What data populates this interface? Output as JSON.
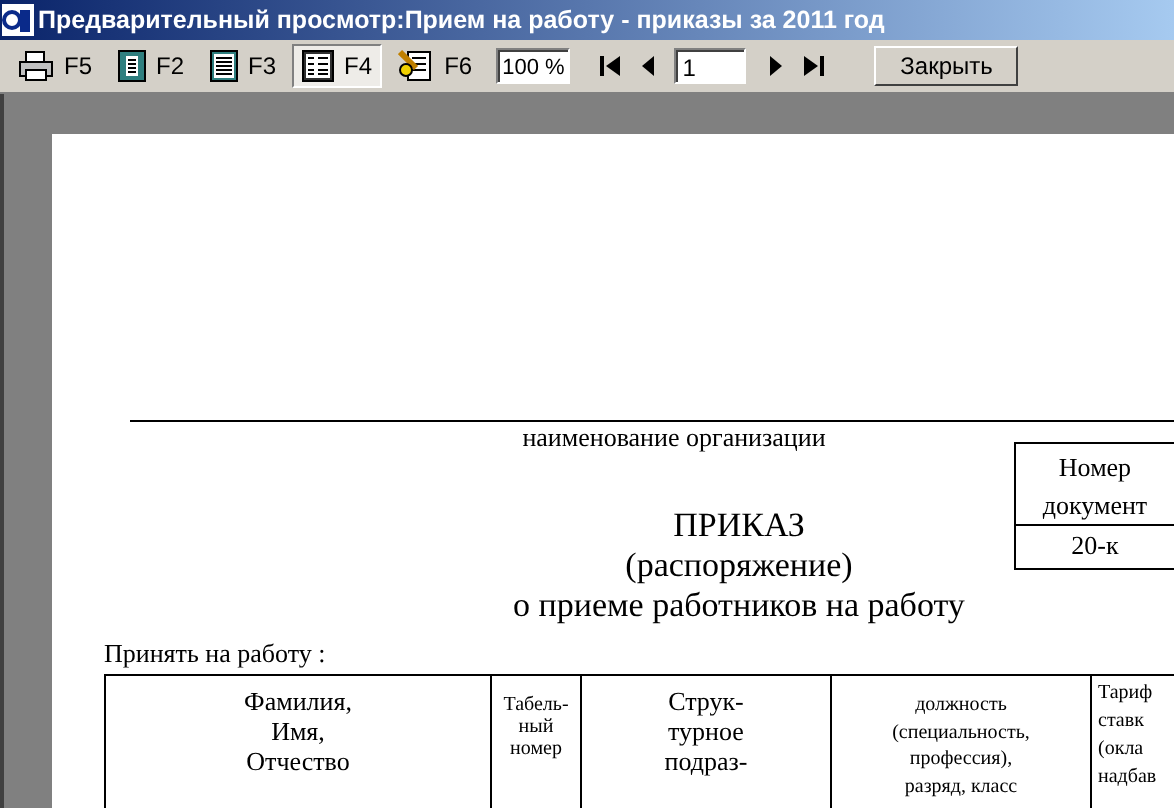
{
  "window": {
    "title": "Предварительный просмотр:Прием на работу - приказы за 2011 год"
  },
  "toolbar": {
    "buttons": [
      {
        "kind": "print",
        "label": "F5",
        "selected": false
      },
      {
        "kind": "page-one",
        "label": "F2",
        "selected": false
      },
      {
        "kind": "page-list",
        "label": "F3",
        "selected": false
      },
      {
        "kind": "page-grid",
        "label": "F4",
        "selected": true
      },
      {
        "kind": "edit",
        "label": "F6",
        "selected": false
      }
    ],
    "zoom": "100 %",
    "page": "1",
    "close_button": "Закрыть"
  },
  "document": {
    "org_caption": "наименование организации",
    "number_box": {
      "header": [
        "Номер",
        "документ"
      ],
      "value": "20-к"
    },
    "title": [
      "ПРИКАЗ",
      "(распоряжение)",
      "о приеме работников на работу"
    ],
    "intro": "Принять на работу :",
    "table": {
      "columns": [
        {
          "lines": [
            "Фамилия,",
            "Имя,",
            "Отчество"
          ]
        },
        {
          "lines": [
            "Табель-",
            "ный",
            "номер"
          ]
        },
        {
          "lines": [
            "Струк-",
            "турное",
            "подраз-"
          ]
        },
        {
          "lines": [
            "должность",
            "(специальность,",
            "профессия),",
            "разряд, класс"
          ]
        },
        {
          "lines": [
            "Тариф",
            "ставк",
            "(окла",
            "надбав"
          ]
        }
      ]
    }
  }
}
